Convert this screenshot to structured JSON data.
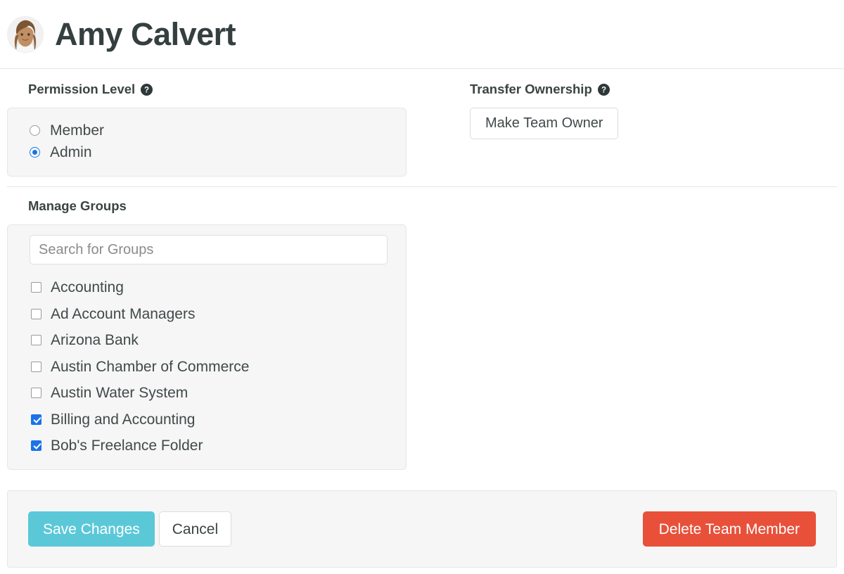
{
  "header": {
    "name": "Amy Calvert",
    "avatar_icon": "user-photo-avatar"
  },
  "permission": {
    "label": "Permission Level",
    "help_icon": "help-circle-icon",
    "options": [
      {
        "label": "Member",
        "selected": false
      },
      {
        "label": "Admin",
        "selected": true
      }
    ]
  },
  "transfer": {
    "label": "Transfer Ownership",
    "help_icon": "help-circle-icon",
    "button_label": "Make Team Owner"
  },
  "groups": {
    "label": "Manage Groups",
    "search_placeholder": "Search for Groups",
    "search_value": "",
    "items": [
      {
        "label": "Accounting",
        "checked": false
      },
      {
        "label": "Ad Account Managers",
        "checked": false
      },
      {
        "label": "Arizona Bank",
        "checked": false
      },
      {
        "label": "Austin Chamber of Commerce",
        "checked": false
      },
      {
        "label": "Austin Water System",
        "checked": false
      },
      {
        "label": "Billing and Accounting",
        "checked": true
      },
      {
        "label": "Bob's Freelance Folder",
        "checked": true
      }
    ]
  },
  "footer": {
    "save_label": "Save Changes",
    "cancel_label": "Cancel",
    "delete_label": "Delete Team Member"
  },
  "colors": {
    "save": "#5bc8d8",
    "delete": "#e8503a",
    "accent_blue": "#1a73e8",
    "title": "#353f3f",
    "panel_bg": "#f6f6f6"
  }
}
